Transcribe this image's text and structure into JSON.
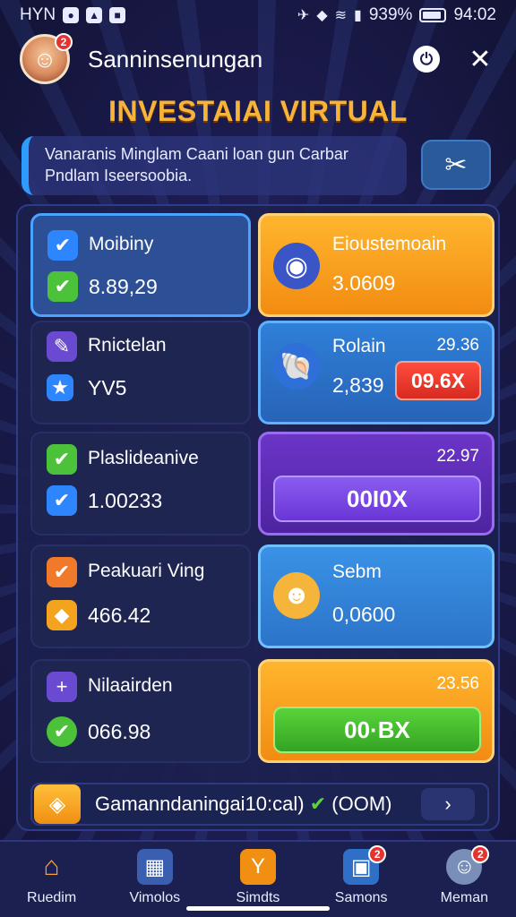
{
  "status_bar": {
    "left_text": "HYN",
    "battery": "939%",
    "time": "94:02"
  },
  "header": {
    "title": "Sanninsenungan",
    "avatar_badge": "2"
  },
  "page_title": "INVESTAIAI VIRTUAL",
  "info": {
    "line1": "Vanaranis Minglam Caani loan gun Carbar",
    "line2": "Pndlam Iseersoobia."
  },
  "left_cards": [
    {
      "label": "Moibiny",
      "value": "8.89,29",
      "icon": "check-icon",
      "value_icon": "check-icon"
    },
    {
      "label": "Rnictelan",
      "value": "YV5",
      "icon": "ticket-icon",
      "value_icon": "star-icon"
    },
    {
      "label": "Plaslideanive",
      "value": "1.00233",
      "icon": "check-icon",
      "value_icon": "check-icon"
    },
    {
      "label": "Peakuari Ving",
      "value": "466.42",
      "icon": "check-icon",
      "value_icon": "tag-icon"
    },
    {
      "label": "Nilaairden",
      "value": "066.98",
      "icon": "plus-box-icon",
      "value_icon": "check-icon"
    }
  ],
  "right_cards": [
    {
      "label": "Eioustemoain",
      "value": "3.0609",
      "icon": "egg-icon"
    },
    {
      "label": "Rolain",
      "value": "2,839",
      "corner": "29.36",
      "badge": "09.6X",
      "icon": "shell-icon"
    },
    {
      "corner": "22.97",
      "button": "00I0X"
    },
    {
      "label": "Sebm",
      "value": "0,0600",
      "icon": "cookie-icon"
    },
    {
      "corner": "23.56",
      "button": "00·BX"
    }
  ],
  "promo": {
    "text": "Gamanndaningai10:cal)",
    "status": "(OOM)"
  },
  "nav": [
    {
      "label": "Ruedim",
      "icon": "home-icon"
    },
    {
      "label": "Vimolos",
      "icon": "chart-icon"
    },
    {
      "label": "Simdts",
      "icon": "trophy-icon"
    },
    {
      "label": "Samons",
      "icon": "box-icon",
      "badge": "2"
    },
    {
      "label": "Meman",
      "icon": "profile-icon",
      "badge": "2"
    }
  ],
  "colors": {
    "accent_gold": "#f7b43a",
    "card_orange": "#f28c12",
    "card_blue": "#2764b8",
    "card_purple": "#4e24a0",
    "button_green": "#34a324",
    "badge_red": "#d82a20"
  }
}
